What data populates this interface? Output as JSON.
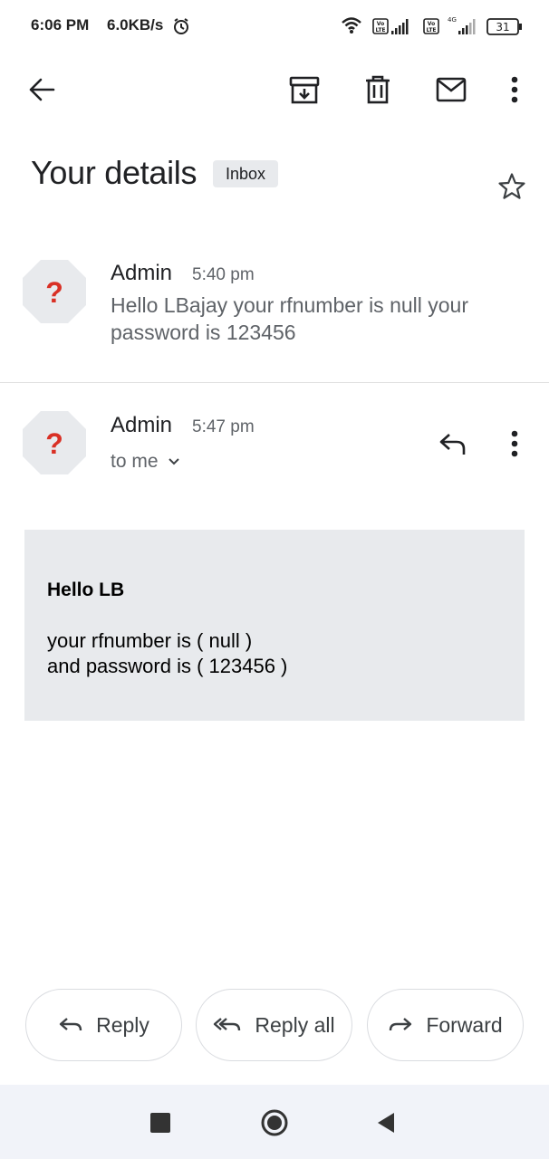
{
  "status_bar": {
    "time": "6:06 PM",
    "speed": "6.0KB/s",
    "battery": "31",
    "network": "4G",
    "volte": "Vo LTE"
  },
  "toolbar": {
    "icons": [
      "back-arrow-icon",
      "archive-icon",
      "delete-icon",
      "mark-unread-icon",
      "more-vert-icon"
    ]
  },
  "thread": {
    "subject": "Your details",
    "label": "Inbox"
  },
  "messages": [
    {
      "sender": "Admin",
      "time": "5:40 pm",
      "snippet": "Hello LBajay your rfnumber is null your password is 123456",
      "avatar_glyph": "?"
    },
    {
      "sender": "Admin",
      "time": "5:47 pm",
      "recipient": "to me",
      "avatar_glyph": "?",
      "body": {
        "greeting": "Hello LB",
        "line1": "your rfnumber is ( null )",
        "line2": "and password is ( 123456 )"
      }
    }
  ],
  "actions": {
    "reply": "Reply",
    "reply_all": "Reply all",
    "forward": "Forward"
  },
  "colors": {
    "avatar_bg": "#e8eaed",
    "avatar_glyph": "#d93025",
    "body_bg": "#e8eaed"
  }
}
